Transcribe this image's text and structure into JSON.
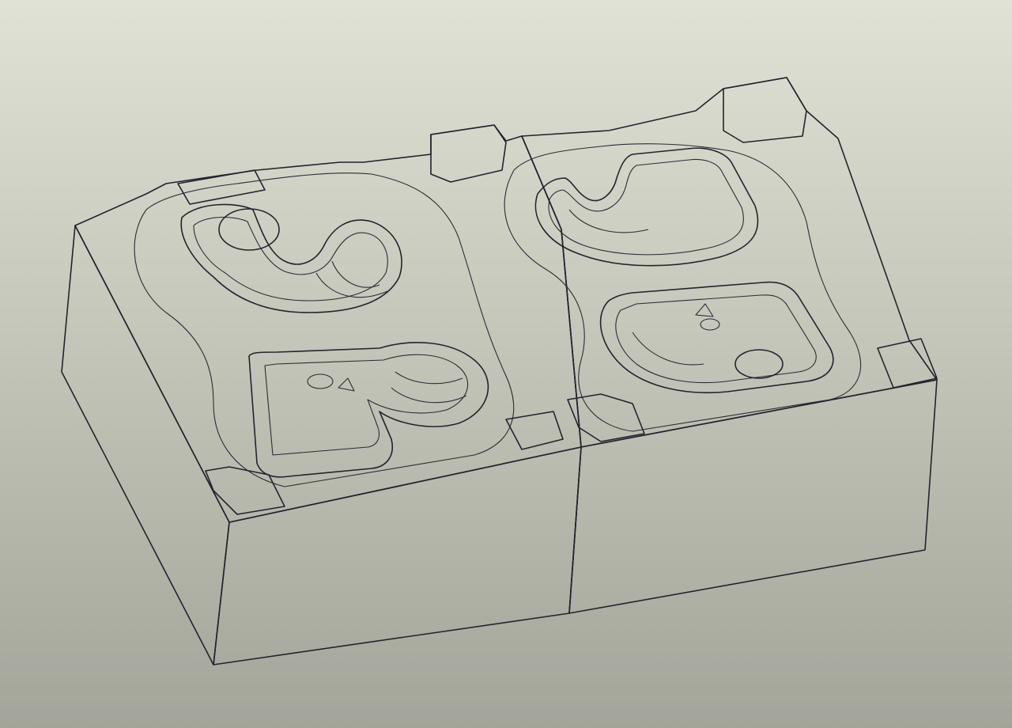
{
  "scene": {
    "subject": "mold-cavity-block",
    "colors": {
      "background_top": "#e1e2d6",
      "background_bottom": "#a3a59a",
      "top_face": "#b5b8d3",
      "left_face": "#a6a8c3",
      "front_face": "#9ea0bc",
      "cavity_floor": "#c4c7de",
      "cavity_wall": "#8d90ae",
      "edge": "#22242e"
    }
  }
}
